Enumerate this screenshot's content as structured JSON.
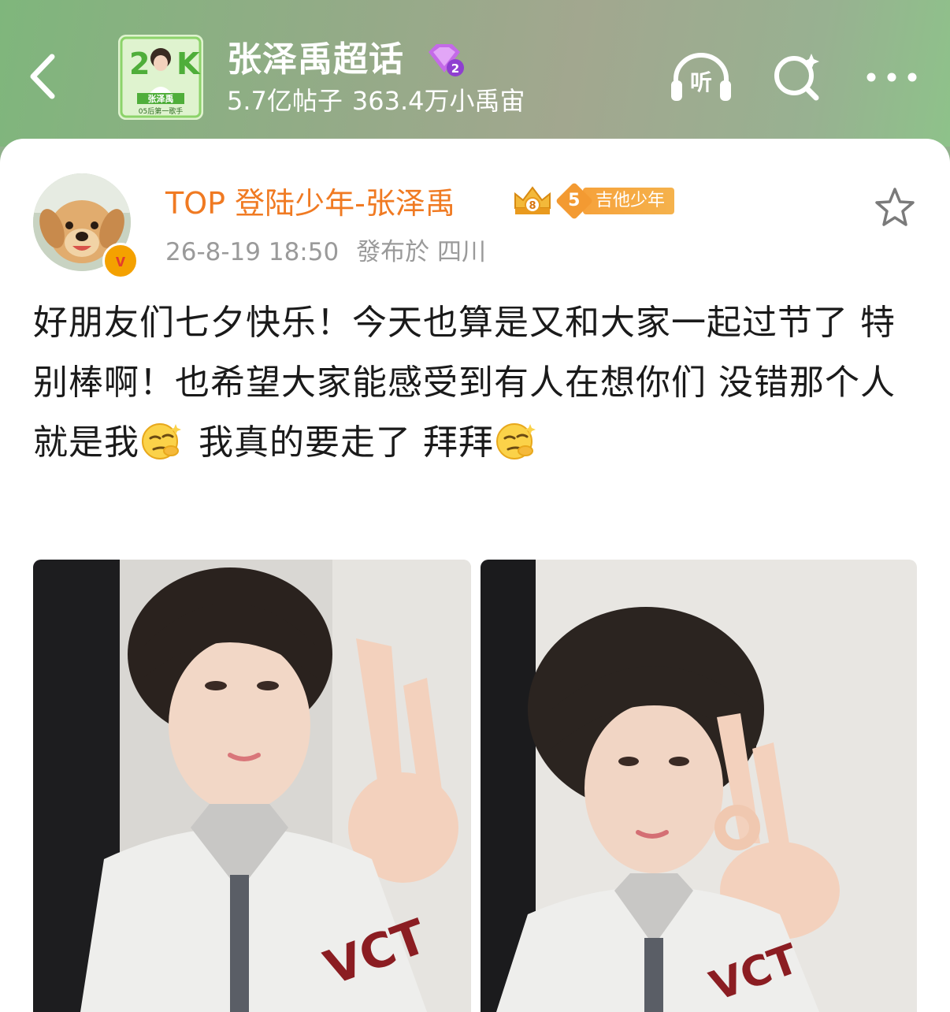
{
  "header": {
    "topic_title": "张泽禹超话",
    "topic_level": "2",
    "posts_count": "5.7亿帖子",
    "fans_count": "363.4万小禹宙",
    "listen_label": "听",
    "thumb_text_name": "张泽禹",
    "thumb_text_sub": "05后第一歌手"
  },
  "post": {
    "author": "TOP 登陆少年-张泽禹",
    "crown_level": "8",
    "fan_level": "5",
    "fan_title": "吉他少年",
    "verified": "v",
    "time": "26-8-19 18:50",
    "location": "發布於 四川",
    "text_part1": "好朋友们七夕快乐！今天也算是又和大家一起过节了 特别棒啊！也希望大家能感受到有人在想你们 没错那个人就是我",
    "text_part2": " 我真的要走了 拜拜",
    "emoji_name": "smirk-emoji"
  },
  "colors": {
    "author": "#f07a22",
    "badge_orange": "#f39a32",
    "meta_gray": "#9a9a9a",
    "header_green": "#8fb18c"
  },
  "icons": [
    "back-arrow-icon",
    "headphones-icon",
    "search-icon",
    "more-icon",
    "star-icon",
    "crown-icon",
    "diamond-icon"
  ]
}
